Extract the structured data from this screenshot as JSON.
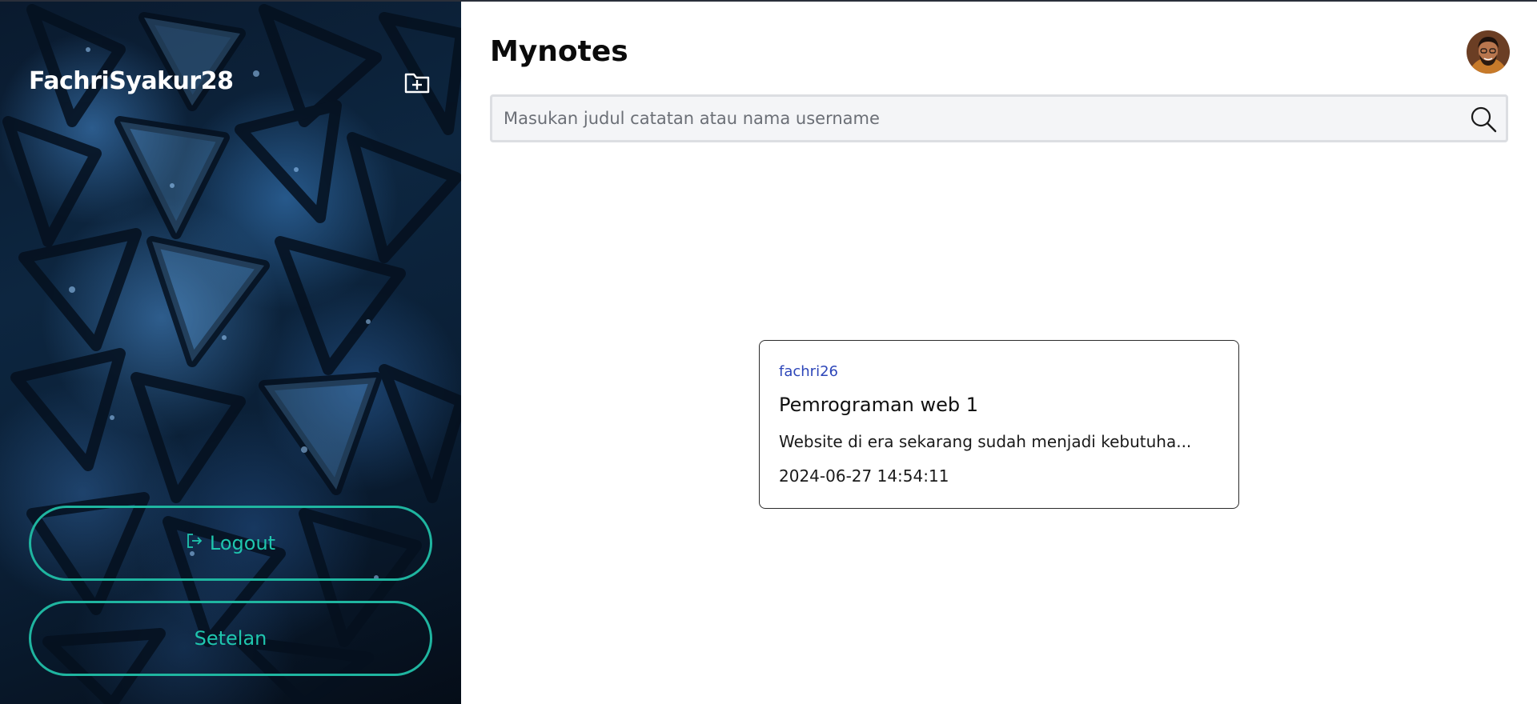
{
  "sidebar": {
    "username": "FachriSyakur28",
    "add_folder_icon": "folder-plus-icon",
    "logout_label": "Logout",
    "logout_icon": "logout-icon",
    "settings_label": "Setelan",
    "button_color": "#1fb5a0"
  },
  "header": {
    "title": "Mynotes",
    "avatar_icon": "user-avatar"
  },
  "search": {
    "placeholder": "Masukan judul catatan atau nama username",
    "value": "",
    "icon": "search-icon"
  },
  "notes": [
    {
      "author": "fachri26",
      "title": "Pemrograman web 1",
      "excerpt": "Website di era sekarang sudah menjadi kebutuha...",
      "date": "2024-06-27 14:54:11"
    }
  ],
  "colors": {
    "author_link": "#2d46b9",
    "sidebar_dark": "#0a1a2e"
  }
}
